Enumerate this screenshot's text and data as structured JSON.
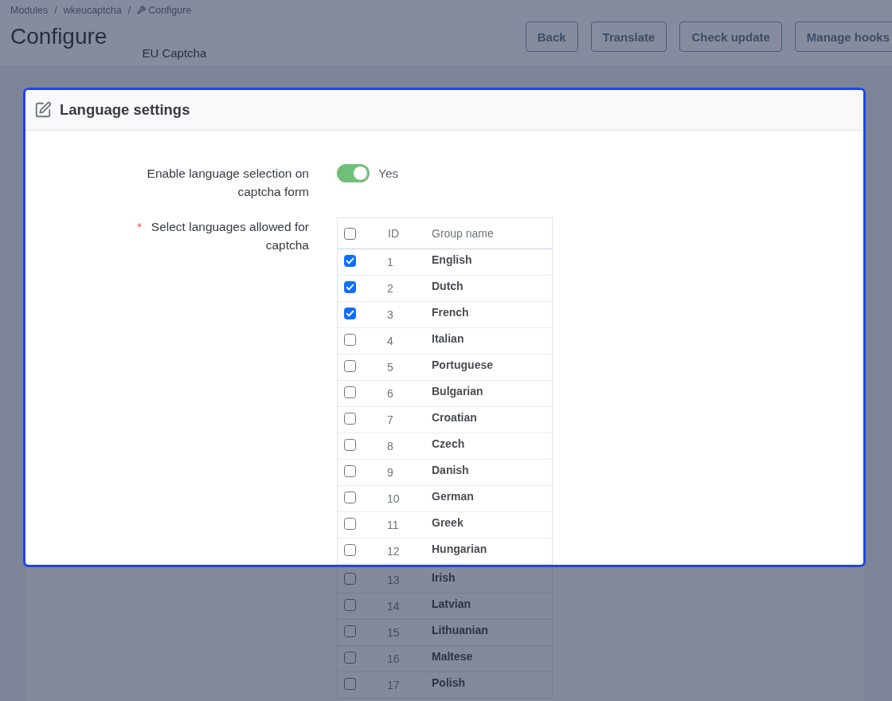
{
  "breadcrumb": [
    {
      "label": "Modules",
      "kind": "link",
      "separator": "/"
    },
    {
      "label": "wkeucaptcha",
      "kind": "link",
      "separator": "/"
    },
    {
      "label": "Configure",
      "kind": "current"
    }
  ],
  "header": {
    "title": "Configure",
    "subtitle": "EU Captcha",
    "buttons": [
      {
        "label": "Back"
      },
      {
        "label": "Translate"
      },
      {
        "label": "Check update"
      },
      {
        "label": "Manage hooks"
      }
    ]
  },
  "panel": {
    "title": "Language settings",
    "fields": [
      {
        "kind": "switch",
        "label": "Enable language selection on captcha form",
        "on": true,
        "state_label": "Yes"
      },
      {
        "kind": "table",
        "label": "Select languages allowed for captcha",
        "required": true,
        "required_mark": "*",
        "select_all": {
          "checked": false
        },
        "columns": [
          {
            "label": "ID"
          },
          {
            "label": "Group name"
          }
        ],
        "rows": [
          {
            "id": "1",
            "name": "English",
            "checked": true
          },
          {
            "id": "2",
            "name": "Dutch",
            "checked": true
          },
          {
            "id": "3",
            "name": "French",
            "checked": true
          },
          {
            "id": "4",
            "name": "Italian",
            "checked": false
          },
          {
            "id": "5",
            "name": "Portuguese",
            "checked": false
          },
          {
            "id": "6",
            "name": "Bulgarian",
            "checked": false
          },
          {
            "id": "7",
            "name": "Croatian",
            "checked": false
          },
          {
            "id": "8",
            "name": "Czech",
            "checked": false
          },
          {
            "id": "9",
            "name": "Danish",
            "checked": false
          },
          {
            "id": "10",
            "name": "German",
            "checked": false
          },
          {
            "id": "11",
            "name": "Greek",
            "checked": false
          },
          {
            "id": "12",
            "name": "Hungarian",
            "checked": false
          },
          {
            "id": "13",
            "name": "Irish",
            "checked": false
          },
          {
            "id": "14",
            "name": "Latvian",
            "checked": false
          },
          {
            "id": "15",
            "name": "Lithuanian",
            "checked": false
          },
          {
            "id": "16",
            "name": "Maltese",
            "checked": false
          },
          {
            "id": "17",
            "name": "Polish",
            "checked": false
          }
        ]
      }
    ]
  }
}
